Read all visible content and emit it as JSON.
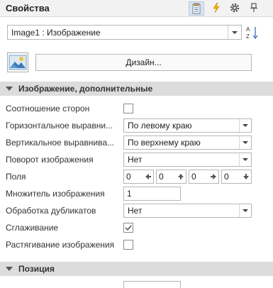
{
  "panel": {
    "title": "Свойства"
  },
  "header_icons": [
    "properties-icon",
    "events-lightning-icon",
    "gear-icon",
    "pin-icon"
  ],
  "component_select": {
    "value": "Image1 : Изображение"
  },
  "design_button": {
    "label": "Дизайн..."
  },
  "sections": {
    "image_extra": {
      "title": "Изображение, дополнительные"
    },
    "position": {
      "title": "Позиция"
    }
  },
  "props": {
    "aspect_ratio": {
      "label": "Соотношение сторон",
      "checked": false
    },
    "h_align": {
      "label": "Горизонтальное выравни...",
      "value": "По левому краю"
    },
    "v_align": {
      "label": "Вертикальное выравнива...",
      "value": "По верхнему краю"
    },
    "rotation": {
      "label": "Поворот изображения",
      "value": "Нет"
    },
    "margins": {
      "label": "Поля",
      "values": [
        "0",
        "0",
        "0",
        "0"
      ]
    },
    "multiplier": {
      "label": "Множитель изображения",
      "value": "1"
    },
    "duplicates": {
      "label": "Обработка дубликатов",
      "value": "Нет"
    },
    "smoothing": {
      "label": "Сглаживание",
      "checked": true
    },
    "stretch": {
      "label": "Растягивание изображения",
      "checked": false
    }
  }
}
